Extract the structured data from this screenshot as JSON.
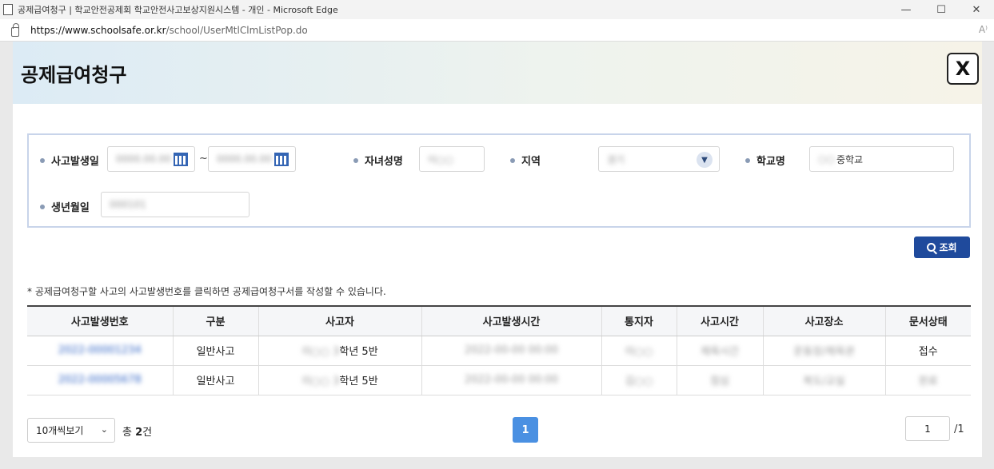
{
  "window": {
    "title": "공제급여청구 | 학교안전공제회 학교안전사고보상지원시스템 - 개인 - Microsoft Edge",
    "url_host": "https://www.schoolsafe.or.kr",
    "url_path": "/school/UserMtlClmListPop.do"
  },
  "popup": {
    "title": "공제급여청구",
    "close_label": "X"
  },
  "search": {
    "accident_date_label": "사고발생일",
    "date_from": "0000.00.00",
    "date_to": "0000.00.00",
    "range_sep": "~",
    "child_name_label": "자녀성명",
    "child_name_value": "이○○",
    "region_label": "지역",
    "region_value": "경기",
    "school_label": "학교명",
    "school_prefix": "○○",
    "school_suffix": "중학교",
    "birth_label": "생년월일",
    "birth_value": "000101",
    "button_label": "조회"
  },
  "notice": "* 공제급여청구할 사고의 사고발생번호를 클릭하면 공제급여청구서를 작성할 수 있습니다.",
  "table": {
    "headers": [
      "사고발생번호",
      "구분",
      "사고자",
      "사고발생시간",
      "통지자",
      "사고시간",
      "사고장소",
      "문서상태"
    ],
    "rows": [
      {
        "id": "2022-00001234",
        "type": "일반사고",
        "victim_blur": "이○○ 3",
        "victim_suffix": "학년 5반",
        "time": "2022-00-00 00:00",
        "reporter": "이○○",
        "period": "체육시간",
        "place": "운동장/체육관",
        "status": "접수"
      },
      {
        "id": "2022-00005678",
        "type": "일반사고",
        "victim_blur": "이○○ 3",
        "victim_suffix": "학년 5반",
        "time": "2022-00-00 00:00",
        "reporter": "김○○",
        "period": "점심",
        "place": "복도/교실",
        "status": "완료"
      }
    ]
  },
  "pager": {
    "page_size_label": "10개씩보기",
    "total_prefix": "총 ",
    "total_count": "2",
    "total_suffix": "건",
    "current_page": "1",
    "page_input": "1",
    "page_total": "/1"
  }
}
